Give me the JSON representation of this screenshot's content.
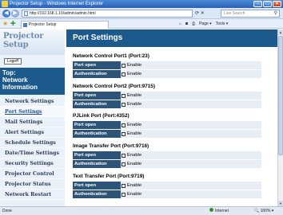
{
  "window": {
    "title": "Projector Setup - Windows Internet Explorer",
    "minimize": "‒",
    "maximize": "□",
    "close": "✕"
  },
  "browser": {
    "address": "http://192.168.1.10/admin/admin.html",
    "search_placeholder": "Live Search",
    "tab_title": "Projector Setup",
    "page_menu": "Page ▾",
    "tools_menu": "Tools ▾"
  },
  "sidebar": {
    "logo": "Projector Setup",
    "logoff": "Logoff",
    "top_nav": "Top:\nNetwork\nInformation",
    "items": [
      {
        "label": "Network Settings"
      },
      {
        "label": "Port Settings"
      },
      {
        "label": "Mail Settings"
      },
      {
        "label": "Alert Settings"
      },
      {
        "label": "Schedule Settings"
      },
      {
        "label": "Date/Time Settings"
      },
      {
        "label": "Security Settings"
      },
      {
        "label": "Projector Control"
      },
      {
        "label": "Projector Status"
      },
      {
        "label": "Network Restart"
      }
    ],
    "active_index": 1
  },
  "main": {
    "title": "Port Settings",
    "sections": [
      {
        "title": "Network Control Port1 (Port:23)",
        "rows": [
          {
            "label": "Port open",
            "value": "Enable"
          },
          {
            "label": "Authentication",
            "value": "Enable"
          }
        ]
      },
      {
        "title": "Network Control Port2 (Port:9715)",
        "rows": [
          {
            "label": "Port open",
            "value": "Enable"
          },
          {
            "label": "Authentication",
            "value": "Enable"
          }
        ]
      },
      {
        "title": "PJLink Port (Port:4352)",
        "rows": [
          {
            "label": "Port open",
            "value": "Enable"
          },
          {
            "label": "Authentication",
            "value": "Enable"
          }
        ]
      },
      {
        "title": "Image Transfer Port (Port:9716)",
        "rows": [
          {
            "label": "Port open",
            "value": "Enable"
          },
          {
            "label": "Authentication",
            "value": "Enable"
          }
        ]
      },
      {
        "title": "Text Transfer Port (Port:9719)",
        "rows": [
          {
            "label": "Port open",
            "value": "Enable"
          },
          {
            "label": "Authentication",
            "value": "Enable"
          }
        ]
      }
    ]
  },
  "status": {
    "left": "Done",
    "zone": "Internet",
    "zoom": "100%"
  }
}
